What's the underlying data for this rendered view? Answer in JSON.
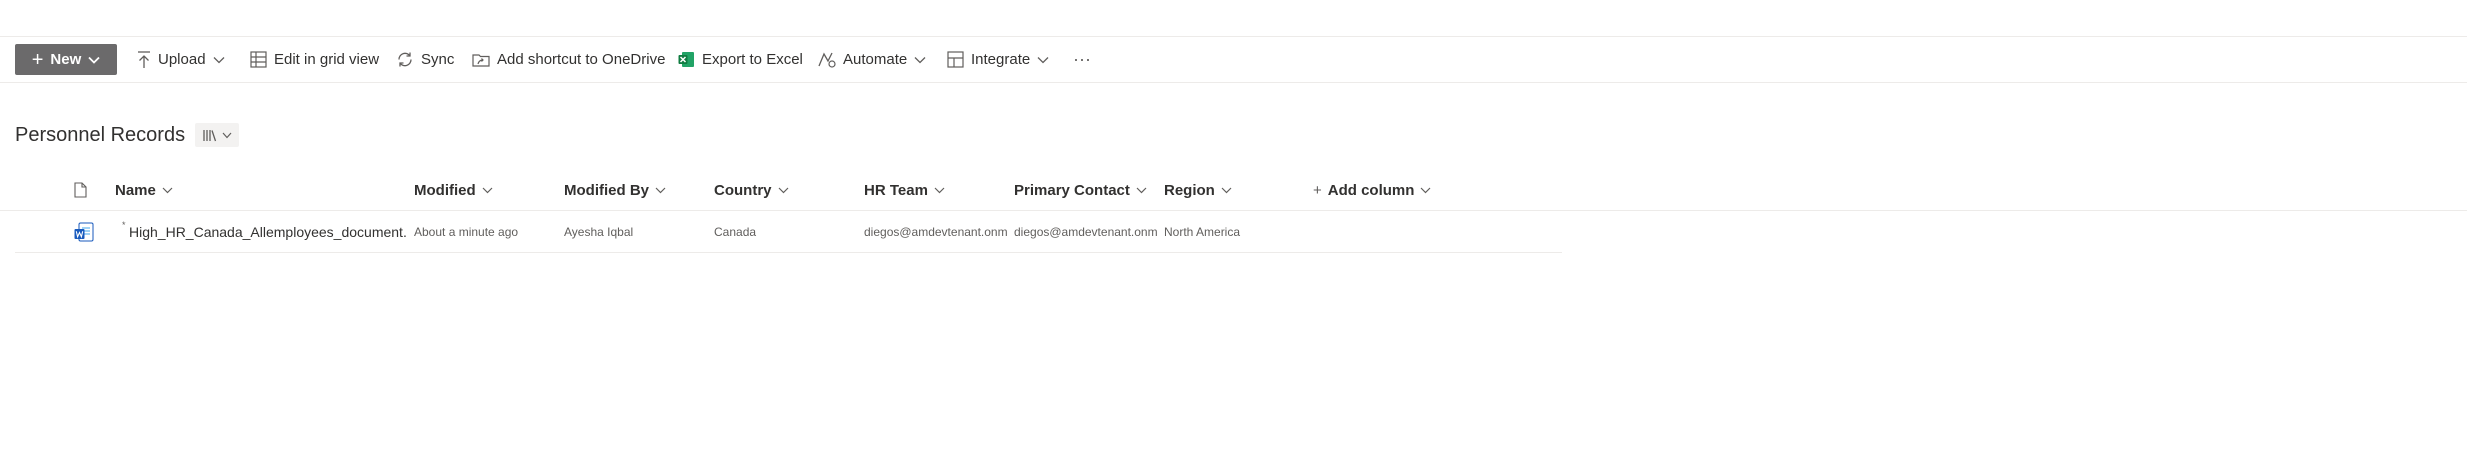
{
  "toolbar": {
    "new_label": "New",
    "upload_label": "Upload",
    "grid_label": "Edit in grid view",
    "sync_label": "Sync",
    "shortcut_label": "Add shortcut to OneDrive",
    "excel_label": "Export to Excel",
    "automate_label": "Automate",
    "integrate_label": "Integrate",
    "more_label": "···"
  },
  "library": {
    "title": "Personnel Records"
  },
  "columns": {
    "name": "Name",
    "modified": "Modified",
    "modified_by": "Modified By",
    "country": "Country",
    "hr_team": "HR Team",
    "primary_contact": "Primary Contact",
    "region": "Region",
    "add_column": "Add column"
  },
  "rows": [
    {
      "name": "High_HR_Canada_Allemployees_document....",
      "modified": "About a minute ago",
      "modified_by": "Ayesha Iqbal",
      "country": "Canada",
      "hr_team": "diegos@amdevtenant.onm",
      "primary_contact": "diegos@amdevtenant.onm",
      "region": "North America"
    }
  ],
  "colors": {
    "new_button_bg": "#6b6a6b",
    "word_icon": "#185abd",
    "excel_icon": "#107c41",
    "divider": "#edebe9"
  }
}
